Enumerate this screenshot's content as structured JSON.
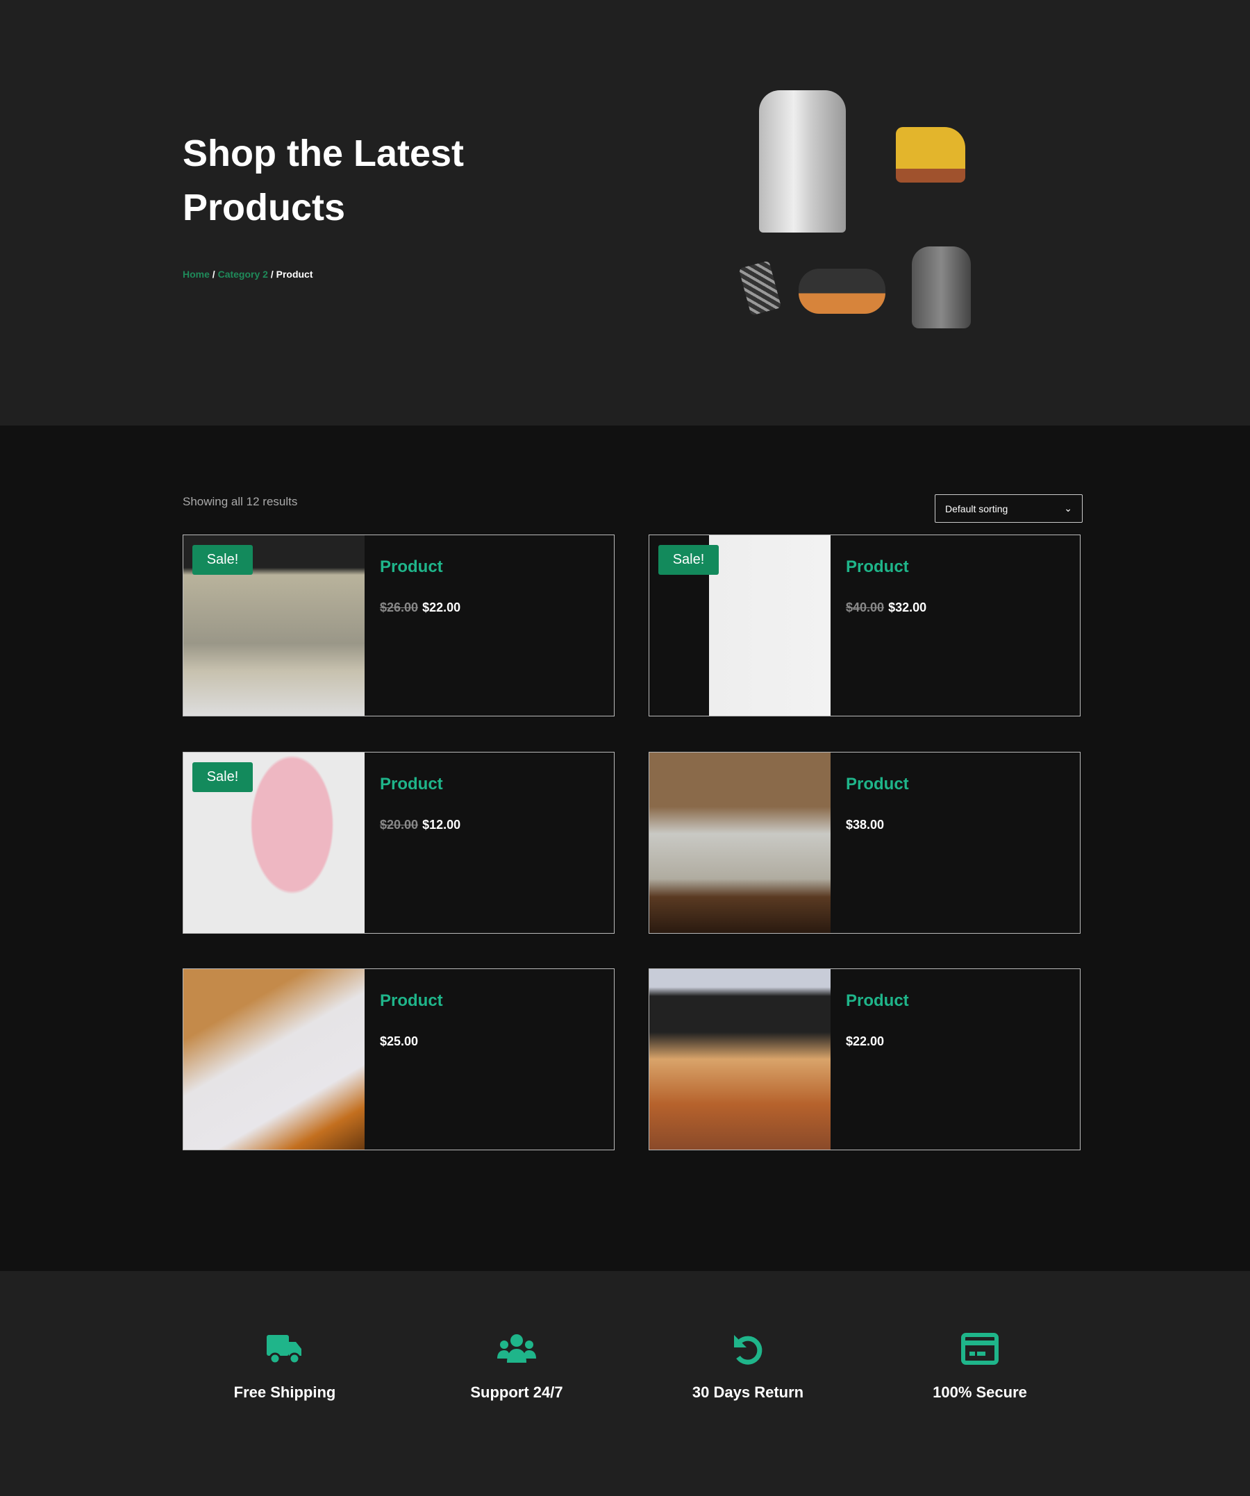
{
  "hero": {
    "title_line1": "Shop the Latest",
    "title_line2": "Products",
    "breadcrumb": [
      {
        "label": "Home"
      },
      {
        "label": "Category 2"
      },
      {
        "label": "Product"
      }
    ],
    "separator": "/"
  },
  "shop": {
    "result_count": "Showing all 12 results",
    "sort_selected": "Default sorting",
    "sale_label": "Sale!",
    "products": [
      {
        "title": "Product",
        "old_price": "$26.00",
        "price": "$22.00",
        "sale": true
      },
      {
        "title": "Product",
        "old_price": "$40.00",
        "price": "$32.00",
        "sale": true
      },
      {
        "title": "Product",
        "old_price": "$20.00",
        "price": "$12.00",
        "sale": true
      },
      {
        "title": "Product",
        "old_price": null,
        "price": "$38.00",
        "sale": false
      },
      {
        "title": "Product",
        "old_price": null,
        "price": "$25.00",
        "sale": false
      },
      {
        "title": "Product",
        "old_price": null,
        "price": "$22.00",
        "sale": false
      }
    ]
  },
  "features": [
    {
      "icon": "truck-icon",
      "label": "Free Shipping"
    },
    {
      "icon": "users-icon",
      "label": "Support 24/7"
    },
    {
      "icon": "undo-icon",
      "label": "30 Days Return"
    },
    {
      "icon": "credit-card-icon",
      "label": "100% Secure"
    }
  ],
  "colors": {
    "accent": "#1fb58a",
    "sale_badge": "#138a5c",
    "hero_bg": "#202020",
    "main_bg": "#111111"
  }
}
